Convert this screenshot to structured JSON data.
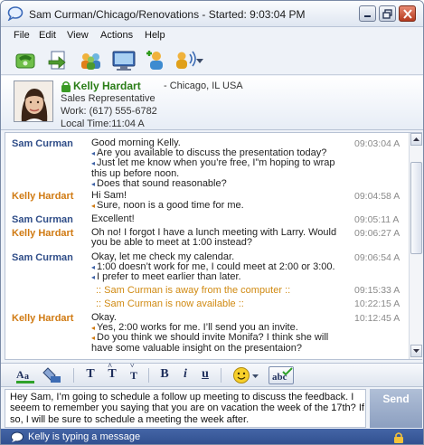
{
  "window": {
    "title": "Sam Curman/Chicago/Renovations - Started: 9:03:04 PM"
  },
  "menu": [
    "File",
    "Edit",
    "View",
    "Actions",
    "Help"
  ],
  "toolbar": {
    "icons": [
      "phone-call-icon",
      "transfer-icon",
      "group-icon",
      "screen-share-icon",
      "add-person-icon",
      "audio-icon"
    ]
  },
  "contact": {
    "name": "Kelly Hardart",
    "location": "- Chicago, IL USA",
    "role": "Sales Representative",
    "work": "Work: (617) 555-6782",
    "local_time": "Local Time:11:04 A"
  },
  "messages": [
    {
      "sender": "Sam Curman",
      "who": "sam",
      "lines": [
        "Good morning Kelly.",
        "Are you available to discuss the presentation today?",
        "Just let me know when you’re free, I”m hoping to wrap this up before noon.",
        "Does that sound reasonable?"
      ],
      "time": "09:03:04 A"
    },
    {
      "sender": "Kelly Hardart",
      "who": "kelly",
      "lines": [
        "Hi Sam!",
        "Sure, noon is a good time for me."
      ],
      "time": "09:04:58 A"
    },
    {
      "sender": "Sam Curman",
      "who": "sam",
      "lines": [
        "Excellent!"
      ],
      "time": "09:05:11 A"
    },
    {
      "sender": "Kelly Hardart",
      "who": "kelly",
      "lines": [
        "Oh no! I forgot I have a lunch meeting with Larry. Would you be able to meet at 1:00 instead?"
      ],
      "time": "09:06:27 A"
    },
    {
      "sender": "Sam Curman",
      "who": "sam",
      "lines": [
        "Okay, let me check my calendar.",
        "1:00 doesn’t work for me, I could meet at 2:00 or 3:00.",
        "I prefer to meet earlier than later."
      ],
      "time": "09:06:54 A"
    },
    {
      "status": ":: Sam Curman is away from the computer ::",
      "time": "09:15:33 A"
    },
    {
      "status": ":: Sam Curman is now available ::",
      "time": "10:22:15 A"
    },
    {
      "sender": "Kelly Hardart",
      "who": "kelly",
      "lines": [
        "Okay.",
        "Yes, 2:00 works for me. I’ll send you an invite.",
        "Do you think we should invite Monifa? I think she will have some valuable insight on the presentaion?"
      ],
      "time": "10:12:45 A"
    }
  ],
  "format": {
    "bold": "B",
    "italic": "i",
    "underline": "u",
    "spell": "abc",
    "text_t": "T"
  },
  "compose": {
    "text": "Hey Sam, I’m going to schedule a follow up meeting to discuss the feedback. I seeem to remember you saying that you are on vacation the week of the 17th? If so, I will be sure to schedule a meeting the week after."
  },
  "send_label": "Send",
  "status": {
    "text": "Kelly is typing a message"
  }
}
